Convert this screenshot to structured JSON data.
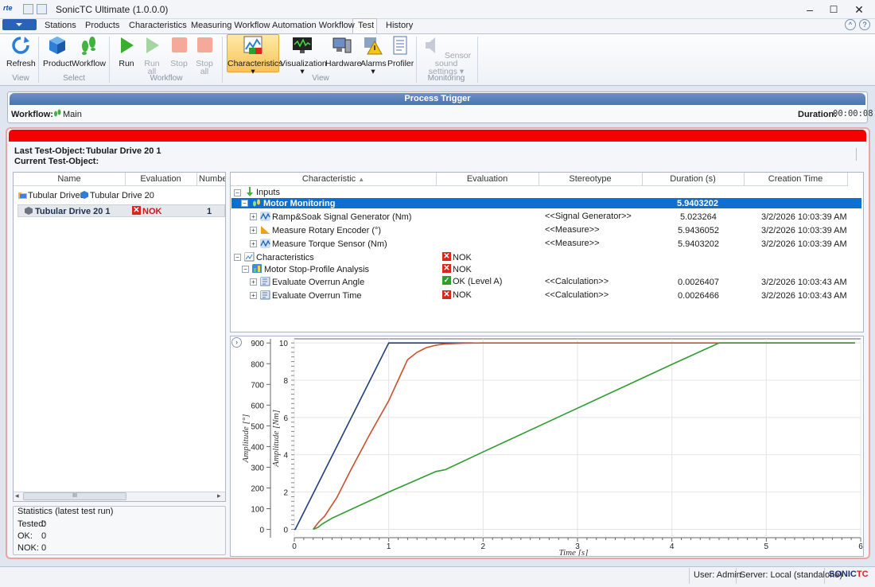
{
  "app": {
    "title": "SonicTC Ultimate (1.0.0.0)",
    "logo": "rte"
  },
  "window_controls": {
    "minimize": "–",
    "maximize": "☐",
    "close": "✕"
  },
  "ribbon_tabs": [
    "Stations",
    "Products",
    "Characteristics",
    "Measuring Workflow",
    "Automation Workflow",
    "Test",
    "History"
  ],
  "active_tab": "Test",
  "ribbon": {
    "refresh": "Refresh",
    "product": "Product",
    "workflow": "Workflow",
    "run": "Run",
    "run_all_1": "Run",
    "run_all_2": "all",
    "stop": "Stop",
    "stop_all_1": "Stop",
    "stop_all_2": "all",
    "characteristics": "Characteristics",
    "visualization": "Visualization",
    "hardware": "Hardware",
    "alarms": "Alarms",
    "profiler": "Profiler",
    "sensor_sound_1": "Sensor sound",
    "sensor_sound_2": "settings",
    "groups": {
      "view": "View",
      "select": "Select",
      "workflow": "Workflow",
      "view2": "View",
      "monitoring": "Monitoring"
    }
  },
  "process_trigger": {
    "header": "Process Trigger",
    "workflow_label": "Workflow:",
    "workflow_value": "Main",
    "duration_label": "Duration:",
    "duration_value": "00:00:08"
  },
  "test_object": {
    "last_label": "Last Test-Object:",
    "last_value": "Tubular Drive 20 1",
    "current_label": "Current Test-Object:",
    "current_value": ""
  },
  "left_grid": {
    "headers": [
      "Name",
      "Evaluation",
      "Numbe"
    ],
    "breadcrumb_1": "Tubular Drives",
    "breadcrumb_2": "Tubular Drive 20",
    "row": {
      "name": "Tubular Drive 20 1",
      "evaluation": "NOK",
      "number": "1"
    },
    "scroll_grip": "III"
  },
  "statistics": {
    "title": "Statistics (latest test run)",
    "tested_label": "Tested:",
    "tested": "0",
    "ok_label": "OK:",
    "ok": "0",
    "nok_label": "NOK:",
    "nok": "0"
  },
  "right_grid": {
    "headers": [
      "Characteristic",
      "Evaluation",
      "Stereotype",
      "Duration (s)",
      "Creation Time"
    ],
    "rows": [
      {
        "name": "Inputs",
        "eval": "",
        "stereo": "",
        "dur": "",
        "time": ""
      },
      {
        "name": "Motor Monitoring",
        "eval": "",
        "stereo": "",
        "dur": "5.9403202",
        "time": ""
      },
      {
        "name": "Ramp&Soak Signal Generator (Nm)",
        "eval": "",
        "stereo": "<<Signal Generator>>",
        "dur": "5.023264",
        "time": "3/2/2026 10:03:39 AM"
      },
      {
        "name": "Measure Rotary Encoder (°)",
        "eval": "",
        "stereo": "<<Measure>>",
        "dur": "5.9436052",
        "time": "3/2/2026 10:03:39 AM"
      },
      {
        "name": "Measure Torque Sensor (Nm)",
        "eval": "",
        "stereo": "<<Measure>>",
        "dur": "5.9403202",
        "time": "3/2/2026 10:03:39 AM"
      },
      {
        "name": "Characteristics",
        "eval": "NOK",
        "stereo": "",
        "dur": "",
        "time": ""
      },
      {
        "name": "Motor Stop-Profile Analysis",
        "eval": "NOK",
        "stereo": "",
        "dur": "",
        "time": ""
      },
      {
        "name": "Evaluate Overrun Angle",
        "eval": "OK (Level A)",
        "stereo": "<<Calculation>>",
        "dur": "0.0026407",
        "time": "3/2/2026 10:03:43 AM"
      },
      {
        "name": "Evaluate Overrun Time",
        "eval": "NOK",
        "stereo": "<<Calculation>>",
        "dur": "0.0026466",
        "time": "3/2/2026 10:03:43 AM"
      }
    ]
  },
  "chart_data": {
    "type": "line",
    "xlabel": "Time [s]",
    "ylabel_left": "Amplitude [°]",
    "ylabel_right": "Amplitude [Nm]",
    "xlim": [
      0,
      6
    ],
    "x_ticks": [
      "0",
      "1",
      "2",
      "3",
      "4",
      "5",
      "6"
    ],
    "y_left_ticks": [
      "0",
      "100",
      "200",
      "300",
      "400",
      "500",
      "600",
      "700",
      "800",
      "900"
    ],
    "y_right_ticks": [
      "0",
      "2",
      "4",
      "6",
      "8",
      "10"
    ],
    "ylim_left": [
      -40,
      920
    ],
    "ylim_right": [
      -0.45,
      10.22
    ],
    "grid": true,
    "series": [
      {
        "color": "#1f3f7a",
        "axis": "right",
        "x": [
          0,
          0.01,
          1.0,
          1.9
        ],
        "y": [
          0,
          0,
          10,
          10
        ]
      },
      {
        "color": "#c8502a",
        "axis": "right",
        "x": [
          0.2,
          0.26,
          0.32,
          0.45,
          0.6,
          0.8,
          1.0,
          1.1,
          1.2,
          1.3,
          1.4,
          1.5,
          1.6,
          1.8,
          2.0,
          2.2,
          3.0,
          4.0,
          5.0,
          5.94
        ],
        "y": [
          0,
          0.4,
          0.7,
          1.7,
          3.2,
          5.1,
          6.9,
          8.0,
          9.1,
          9.5,
          9.75,
          9.88,
          9.95,
          9.99,
          10,
          10,
          10,
          10,
          10,
          10
        ]
      },
      {
        "color": "#2f9a2f",
        "axis": "right",
        "x": [
          0.2,
          0.25,
          0.3,
          0.4,
          1.0,
          1.5,
          1.6,
          2.0,
          3.0,
          4.0,
          4.5,
          5.0,
          5.94
        ],
        "y": [
          0,
          0.1,
          0.3,
          0.6,
          2.0,
          3.1,
          3.2,
          4.15,
          6.5,
          8.85,
          10,
          10,
          10
        ]
      }
    ]
  }
}
